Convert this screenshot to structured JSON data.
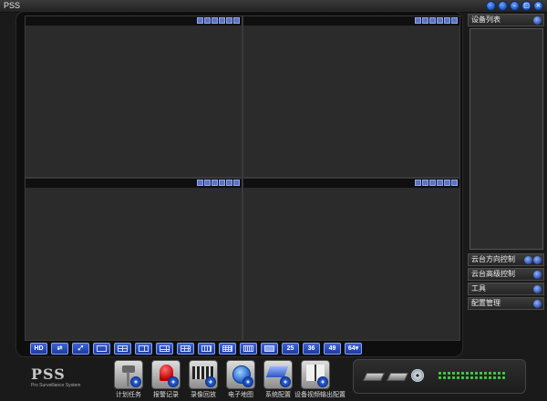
{
  "window": {
    "title": "PSS",
    "buttons": [
      "help",
      "settings",
      "minimize",
      "maximize",
      "close"
    ]
  },
  "video_grid": {
    "cells": 4,
    "cell_toolbar_icons": [
      "record-icon",
      "snapshot-icon",
      "audio-icon",
      "talk-icon",
      "zoom-icon",
      "close-icon"
    ]
  },
  "view_toolbar": {
    "buttons": [
      {
        "label": "HD",
        "icon": null
      },
      {
        "label": "",
        "icon": "switch-icon"
      },
      {
        "label": "",
        "icon": "fullscreen-icon"
      },
      {
        "label": "",
        "icon": "layout-1-icon"
      },
      {
        "label": "",
        "icon": "layout-4-icon"
      },
      {
        "label": "",
        "icon": "layout-6-icon"
      },
      {
        "label": "",
        "icon": "layout-8-icon"
      },
      {
        "label": "",
        "icon": "layout-9-icon"
      },
      {
        "label": "",
        "icon": "layout-13-icon"
      },
      {
        "label": "",
        "icon": "layout-16-icon"
      },
      {
        "label": "",
        "icon": "layout-20-icon"
      },
      {
        "label": "",
        "icon": "layout-custom-icon"
      },
      {
        "label": "25",
        "icon": null
      },
      {
        "label": "36",
        "icon": null
      },
      {
        "label": "49",
        "icon": null
      },
      {
        "label": "64▾",
        "icon": null
      }
    ]
  },
  "right_panel": {
    "device_list": "设备列表",
    "ptz_direction": "云台方向控制",
    "ptz_advanced": "云台高级控制",
    "tools": "工具",
    "config_manage": "配置管理"
  },
  "logo": {
    "name": "PSS",
    "subtitle": "Pro Surveillance System"
  },
  "modules": [
    {
      "label": "计划任务",
      "icon": "camera-icon"
    },
    {
      "label": "报警记录",
      "icon": "alarm-icon"
    },
    {
      "label": "录像回放",
      "icon": "film-icon"
    },
    {
      "label": "电子地图",
      "icon": "ie-map-icon"
    },
    {
      "label": "系统配置",
      "icon": "system-config-icon"
    },
    {
      "label": "设备视频输出配置",
      "icon": "video-output-icon"
    }
  ],
  "status_tray": {
    "icons": [
      "hdd-icon",
      "hdd-icon",
      "cd-icon"
    ]
  }
}
